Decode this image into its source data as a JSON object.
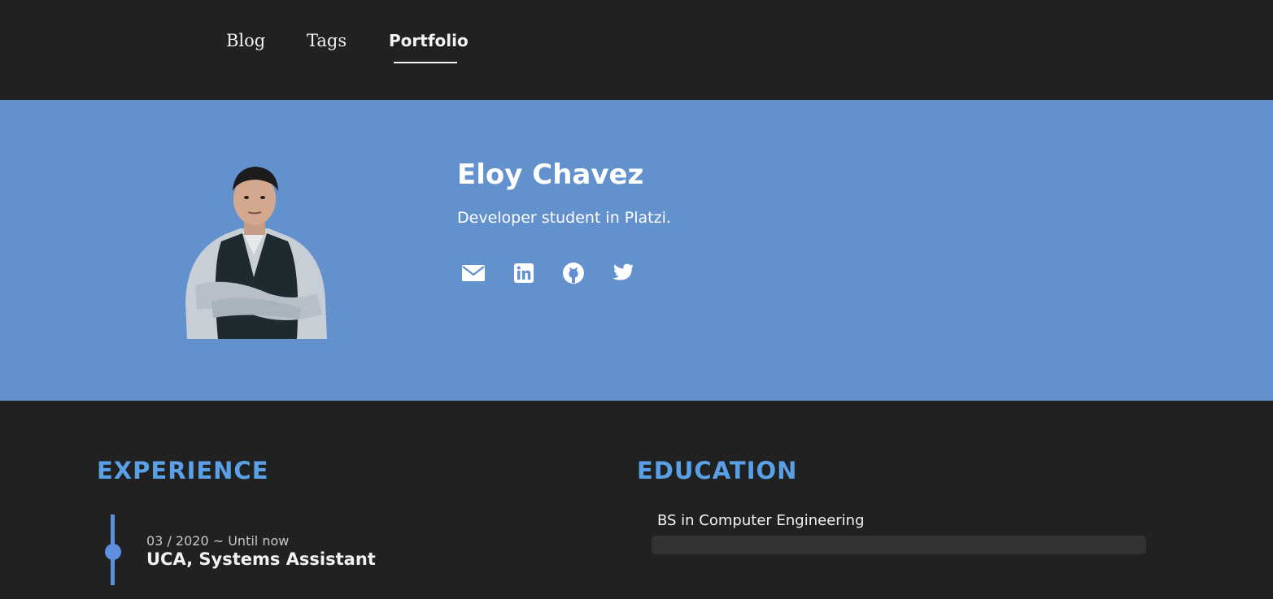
{
  "nav": {
    "items": [
      {
        "label": "Blog"
      },
      {
        "label": "Tags"
      },
      {
        "label": "Portfolio",
        "active": true
      }
    ]
  },
  "hero": {
    "name": "Eloy Chavez",
    "tagline": "Developer student in Platzi.",
    "background": "#6391ce",
    "social": [
      {
        "icon": "mail-icon"
      },
      {
        "icon": "linkedin-icon"
      },
      {
        "icon": "github-icon"
      },
      {
        "icon": "twitter-icon"
      }
    ]
  },
  "experience": {
    "title": "EXPERIENCE",
    "items": [
      {
        "date": "03 / 2020 ~ Until now",
        "role": "UCA, Systems Assistant"
      }
    ]
  },
  "education": {
    "title": "EDUCATION",
    "items": [
      {
        "degree": "BS in Computer Engineering"
      }
    ]
  },
  "colors": {
    "background": "#212121",
    "accent": "#5aa0e6",
    "timeline": "#5e8fe0"
  }
}
